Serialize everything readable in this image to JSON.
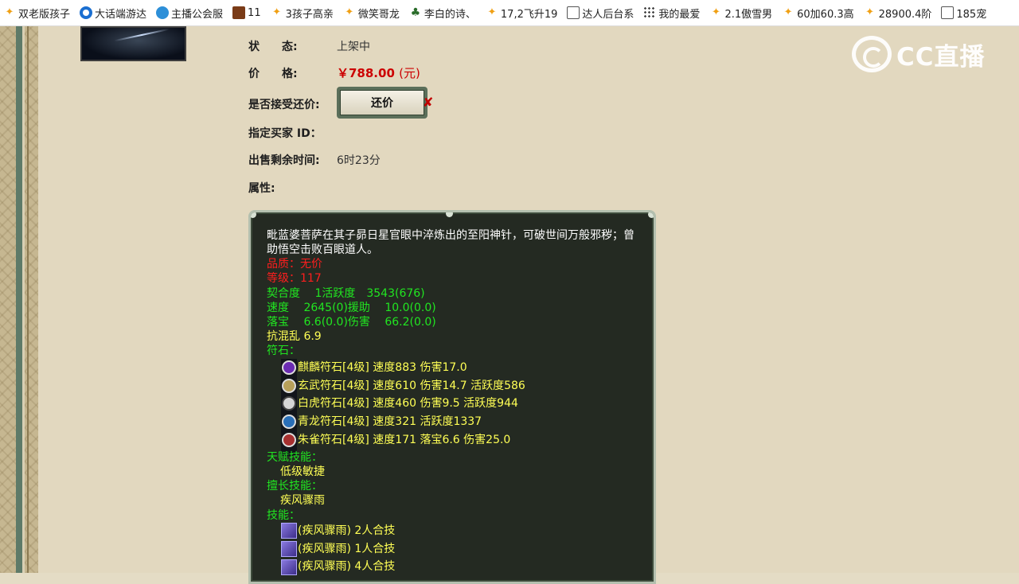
{
  "bookmarks": [
    {
      "icon": "star-icon",
      "label": "双老版孩子"
    },
    {
      "icon": "circle-logo-icon",
      "label": "大话端游达"
    },
    {
      "icon": "cloud-icon",
      "label": "主播公会服"
    },
    {
      "icon": "game-icon",
      "label": "11"
    },
    {
      "icon": "star-icon",
      "label": "3孩子高亲"
    },
    {
      "icon": "star-icon",
      "label": "微笑哥龙"
    },
    {
      "icon": "leaf-icon",
      "label": "李白的诗、"
    },
    {
      "icon": "star-icon",
      "label": "17,2飞升19"
    },
    {
      "icon": "doc-icon",
      "label": "达人后台系"
    },
    {
      "icon": "grid-icon",
      "label": "我的最爱"
    },
    {
      "icon": "star-icon",
      "label": "2.1傲雪男"
    },
    {
      "icon": "star-icon",
      "label": "60加60.3高"
    },
    {
      "icon": "star-icon",
      "label": "28900.4阶"
    },
    {
      "icon": "doc-icon",
      "label": "185宠"
    }
  ],
  "logo": {
    "text": "CC直播"
  },
  "item": {
    "status_label": "状　　态:",
    "status_value": "上架中",
    "price_label": "价　　格:",
    "price_value": "￥788.00",
    "price_unit": "(元)",
    "counter_label": "是否接受还价:",
    "counter_button": "还价",
    "counter_mark": "✘",
    "buyer_label": "指定买家 ID：",
    "time_label": "出售剩余时间:",
    "time_value": "6时23分",
    "attr_label": "属性:"
  },
  "attributes": {
    "description": "毗蓝婆菩萨在其子昴日星官眼中淬炼出的至阳神针，可破世间万般邪秽；曾助悟空击败百眼道人。",
    "quality": "品质：无价",
    "level": "等级：117",
    "stats": [
      "契合度　 1活跃度　3543(676)",
      "速度　 2645(0)援助　 10.0(0.0)",
      "落宝　 6.6(0.0)伤害　 66.2(0.0)"
    ],
    "anti_chaos": "抗混乱 6.9",
    "runes_title": "符石：",
    "runes": [
      {
        "icon": "qilin-rune-icon",
        "text": "麒麟符石[4级] 速度883 伤害17.0"
      },
      {
        "icon": "xuanwu-rune-icon",
        "text": "玄武符石[4级] 速度610 伤害14.7 活跃度586"
      },
      {
        "icon": "baihu-rune-icon",
        "text": "白虎符石[4级] 速度460 伤害9.5 活跃度944"
      },
      {
        "icon": "qinglong-rune-icon",
        "text": "青龙符石[4级] 速度321 活跃度1337"
      },
      {
        "icon": "zhuque-rune-icon",
        "text": "朱雀符石[4级] 速度171 落宝6.6 伤害25.0"
      }
    ],
    "talent_title": "天赋技能：",
    "talent": "低级敏捷",
    "special_title": "擅长技能：",
    "special": "疾风骤雨",
    "skills_title": "技能：",
    "skills": [
      "(疾风骤雨) 2人合技",
      "(疾风骤雨) 1人合技",
      "(疾风骤雨) 4人合技"
    ]
  }
}
